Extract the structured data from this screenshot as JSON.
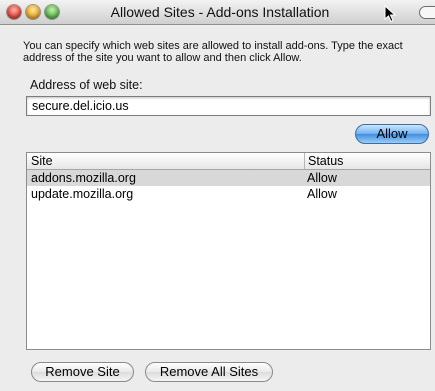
{
  "window": {
    "title": "Allowed Sites - Add-ons Installation"
  },
  "description": "You can specify which web sites are allowed to install add-ons. Type the exact address of the site you want to allow and then click Allow.",
  "address": {
    "label": "Address of web site:",
    "value": "secure.del.icio.us"
  },
  "buttons": {
    "allow": "Allow",
    "remove_site": "Remove Site",
    "remove_all": "Remove All Sites"
  },
  "list": {
    "columns": [
      "Site",
      "Status"
    ],
    "rows": [
      {
        "site": "addons.mozilla.org",
        "status": "Allow"
      },
      {
        "site": "update.mozilla.org",
        "status": "Allow"
      }
    ]
  },
  "colors": {
    "allow_button": "#6fb0ef",
    "selected_row": "#d8d8d8"
  }
}
